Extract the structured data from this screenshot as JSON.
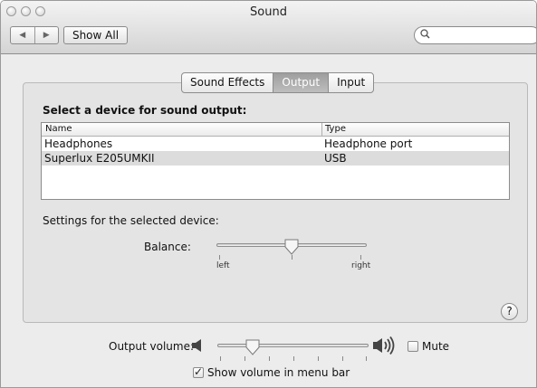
{
  "window": {
    "title": "Sound"
  },
  "toolbar": {
    "back_icon": "◀",
    "forward_icon": "▶",
    "show_all": "Show All",
    "search_icon": "🔍",
    "search_placeholder": ""
  },
  "tabs": [
    {
      "label": "Sound Effects",
      "active": false
    },
    {
      "label": "Output",
      "active": true
    },
    {
      "label": "Input",
      "active": false
    }
  ],
  "output": {
    "heading": "Select a device for sound output:",
    "columns": [
      "Name",
      "Type"
    ],
    "devices": [
      {
        "name": "Headphones",
        "type": "Headphone port",
        "selected": false
      },
      {
        "name": "Superlux E205UMKII",
        "type": "USB",
        "selected": true
      }
    ],
    "settings_label": "Settings for the selected device:",
    "balance": {
      "label": "Balance:",
      "left": "left",
      "right": "right",
      "value": 0.5
    }
  },
  "help": "?",
  "volume": {
    "label": "Output volume:",
    "level": 0.22,
    "mute_label": "Mute",
    "muted": false,
    "show_in_menu_label": "Show volume in menu bar",
    "show_in_menu": true
  }
}
